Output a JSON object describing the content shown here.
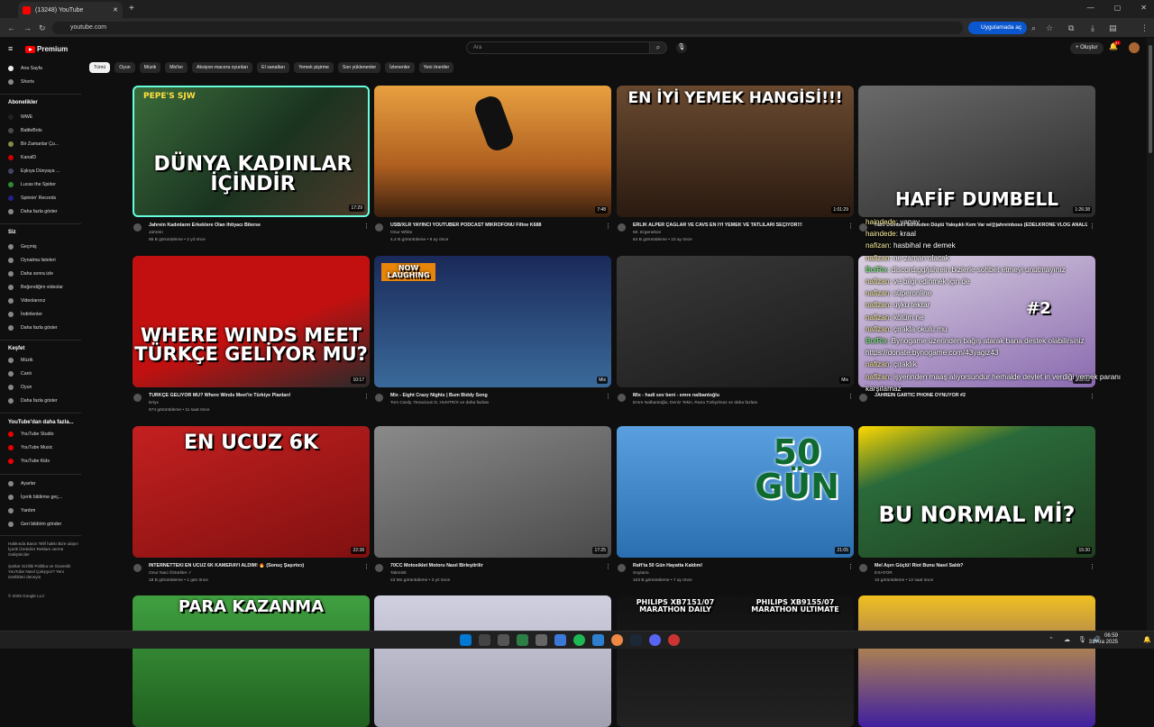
{
  "browser": {
    "tab_title": "(13248) YouTube",
    "url": "youtube.com",
    "app_button": "Uygulamada aç"
  },
  "header": {
    "logo": "Premium",
    "search_placeholder": "Ara",
    "create": "Oluştur",
    "notif_count": "9+"
  },
  "chips": [
    "Tümü",
    "Oyun",
    "Müzik",
    "Mix'ler",
    "Aksiyon-macera oyunları",
    "El sanatları",
    "Yemek pişirme",
    "Son yüklenenler",
    "İzlenenler",
    "Yeni öneriler"
  ],
  "sidebar": {
    "main": [
      "Ana Sayfa",
      "Shorts"
    ],
    "subs_title": "Abonelikler",
    "subs": [
      "WWE",
      "BattleBots",
      "Bir Zamanlar Çu...",
      "KanalD",
      "Eşkıya Dünyaya ...",
      "Lucas the Spider",
      "Spinnin' Records"
    ],
    "show_more": "Daha fazla göster",
    "you_title": "Siz",
    "you": [
      "Geçmiş",
      "Oynatma listeleri",
      "Daha sonra izle",
      "Beğendiğim videolar",
      "Videolarınız",
      "İndirilenler"
    ],
    "explore_title": "Keşfet",
    "explore": [
      "Müzik",
      "Canlı",
      "Oyun"
    ],
    "more_title": "YouTube'dan daha fazla...",
    "more": [
      "YouTube Studio",
      "YouTube Music",
      "YouTube Kids"
    ],
    "settings": [
      "Ayarlar",
      "İçerik bildirme geç...",
      "Yardım",
      "Geri bildirim gönder"
    ],
    "footer1": "Hakkında  Basın  Telif hakkı  Bize ulaşın  İçerik Üreticiler  Reklam verme  Geliştiriciler",
    "footer2": "Şartlar  Gizlilik  Politika ve Güvenlik  YouTube Nasıl Çalışıyor?  Yeni özellikleri deneyin",
    "copyright": "© 2025 Google LLC"
  },
  "videos": [
    {
      "thumb_text": "DÜNYA KADINLAR İÇİNDİR",
      "thumb_sub": "PEPE'S SJW",
      "duration": "17:29",
      "title": "Jahrein Kadınların Erkeklere Olan İhtiyacı Biterse",
      "channel": "Jahrein",
      "meta": "85 B görüntüleme • 2 yıl önce"
    },
    {
      "thumb_text": "",
      "duration": "7:48",
      "title": "USB/XLR YAYINCI YOUTUBER PODCAST MİKROFONU Fifine K688",
      "channel": "Onur White",
      "meta": "4,4 B görüntüleme • 9 ay önce"
    },
    {
      "thumb_text": "EN İYİ YEMEK HANGİSİ!!!",
      "duration": "1:01:29",
      "title": "ERLİK ALPER ÇAĞLAR VE CAVS EN İYİ YEMEK VE TATLILARI SEÇİYOR!!!",
      "channel": "Mr. Ergenekon",
      "meta": "64 B görüntüleme • 10 ay önce"
    },
    {
      "thumb_text": "HAFİF DUMBELL",
      "duration": "1:26:38",
      "title": "Hafif Dumbell Sahneden Düştü Yakışıklı Kem Var w/@jahreinboss (EDELKRONE VLOG ANALİZİ)",
      "channel": "",
      "meta": ""
    },
    {
      "thumb_text": "WHERE WINDS MEET TÜRKÇE GELİYOR MU?",
      "duration": "10:17",
      "title": "TÜRKÇE GELİYOR MU? Where Winds Meet'in Türkiye Planları!",
      "channel": "Ertyx",
      "meta": "674 görüntüleme • 11 saat önce"
    },
    {
      "thumb_text": "NOW LAUGHING",
      "duration": "Mix",
      "title": "Mix - Eight Crazy Nights | Bum Biddy Song",
      "channel": "Tom Cardy, Tenacious D, HUNTR/X ve daha fazlası",
      "meta": ""
    },
    {
      "thumb_text": "",
      "duration": "Mix",
      "title": "Mix - hadi sev beni - emre nalbantoğlu",
      "channel": "Emre Nalbantoğlu, Deniz Tekin, Rana Türkyılmaz ve daha fazlası",
      "meta": ""
    },
    {
      "thumb_text": "#2",
      "duration": "1:02:02",
      "title": "JAHREIN GARTIC PHONE OYNUYOR #2",
      "channel": "",
      "meta": ""
    },
    {
      "thumb_text": "EN UCUZ 6K",
      "duration": "22:38",
      "title": "İNTERNETTEKİ EN UCUZ 6K KAMERAYI ALDIM! 🔥 (Sonuç Şaşırtıcı)",
      "channel": "Onur Naci Öztürkler ✓",
      "meta": "18 B görüntüleme • 1 gün önce"
    },
    {
      "thumb_text": "",
      "duration": "17:25",
      "title": "70CC Motosiklet Motoru Nasıl Birleştirilir",
      "channel": "Talentist",
      "meta": "23 Mn görüntüleme • 3 yıl önce"
    },
    {
      "thumb_text": "50 GÜN",
      "duration": "21:05",
      "title": "Raft'ta 50 Gün Hayatta Kaldım!",
      "channel": "Soytario",
      "meta": "103 B görüntüleme • 7 ay önce"
    },
    {
      "thumb_text": "BU NORMAL Mİ?",
      "duration": "15:30",
      "title": "Mel Aşırı Güçlü! Riot Bunu Nasıl Saldı?",
      "channel": "EXAFOR",
      "meta": "10 görüntüleme • 12 saat önce"
    },
    {
      "thumb_text": "PARA KAZANMA",
      "duration": "",
      "title": "",
      "channel": "",
      "meta": ""
    },
    {
      "thumb_text": "",
      "duration": "",
      "title": "",
      "channel": "",
      "meta": ""
    },
    {
      "thumb_text": "PHILIPS XB7151/07 MARATHON DAILY",
      "thumb_text2": "PHILIPS XB9155/07 MARATHON ULTIMATE",
      "duration": "",
      "title": "",
      "channel": "",
      "meta": ""
    },
    {
      "thumb_text": "",
      "duration": "",
      "title": "",
      "channel": "",
      "meta": ""
    }
  ],
  "chat": [
    {
      "user": "haindede",
      "msg": ": yapay"
    },
    {
      "user": "haindede",
      "msg": ": kraal"
    },
    {
      "user": "nafizan",
      "msg": ": hasbihal ne demek"
    },
    {
      "user": "nafizan",
      "msg": ": ne zaman olacak"
    },
    {
      "user": "BotRix",
      "msg": ": discord.gg/jahrein bizlerle sohbet etmeyi unutmayınız"
    },
    {
      "user": "nafizan",
      "msg": ": ve bilgi edinmek için de"
    },
    {
      "user": "nafizan",
      "msg": ": süperonline"
    },
    {
      "user": "nafizan",
      "msg": ": uyku tekrar"
    },
    {
      "user": "nafizan",
      "msg": ": kötüm ne"
    },
    {
      "user": "nafizan",
      "msg": ": çırakla okulu mu"
    },
    {
      "user": "BotRix",
      "msg": ": Bynogame üzerinden bağış atarak bana destek olabilirsiniz https://donate.bynogame.com/43yagiz43"
    },
    {
      "user": "nafizan",
      "msg": ": çıraklık"
    },
    {
      "user": "nafizan",
      "msg": ": işyerinden maaş alıyorsundur herhalde devlet in verdiği yemek paranı karşılamaz"
    }
  ],
  "taskbar": {
    "time": "06:59",
    "date": "31 Ara 2025"
  }
}
